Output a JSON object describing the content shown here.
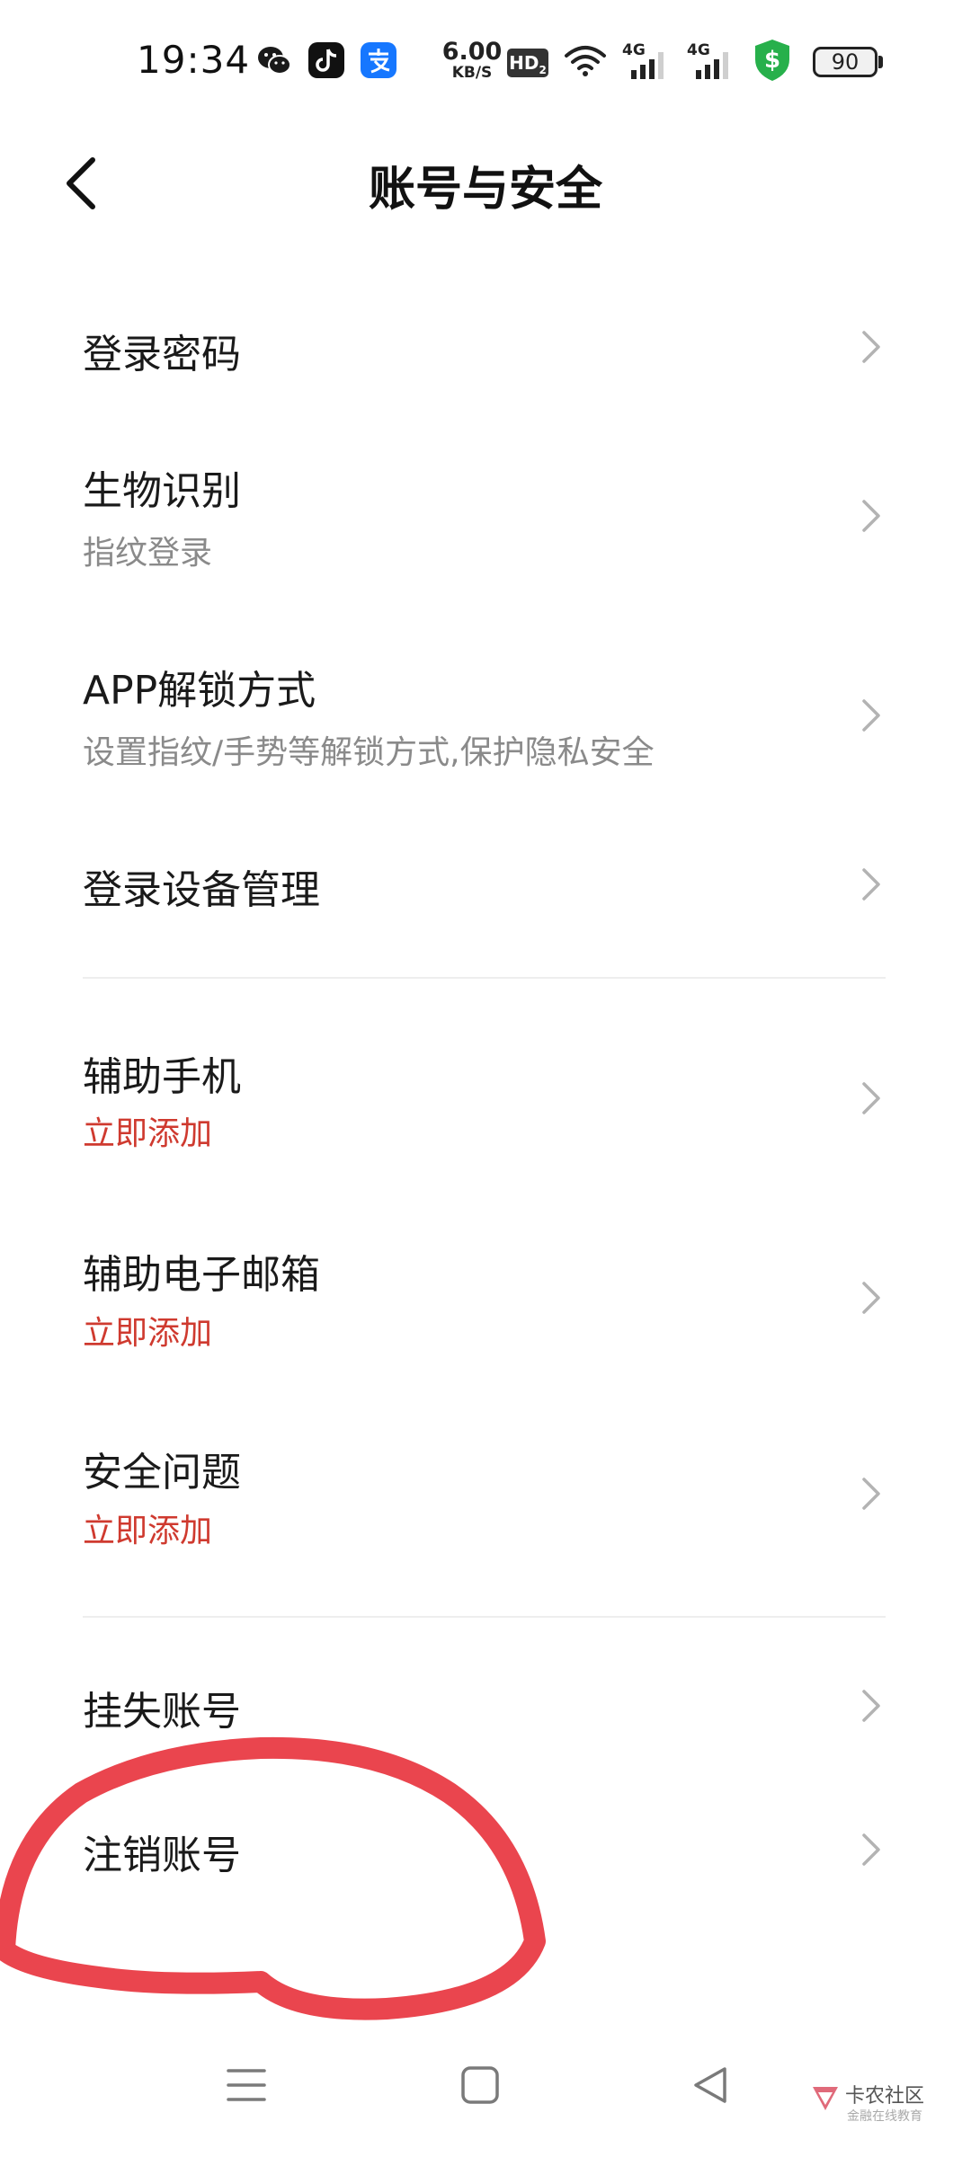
{
  "status_bar": {
    "time": "19:34",
    "net_speed_value": "6.00",
    "net_speed_unit": "KB/S",
    "hd_badge": "HD",
    "hd_sub": "2",
    "signal1_label": "4G",
    "signal2_label": "4G",
    "battery_level": "90",
    "icons": [
      "wechat-icon",
      "tiktok-icon",
      "alipay-icon",
      "hd-icon",
      "wifi-icon",
      "signal-icon",
      "signal-icon",
      "shield-dollar-icon",
      "battery-icon"
    ]
  },
  "header": {
    "title": "账号与安全"
  },
  "settings": {
    "items": [
      {
        "title": "登录密码",
        "subtitle": ""
      },
      {
        "title": "生物识别",
        "subtitle": "指纹登录"
      },
      {
        "title": "APP解锁方式",
        "subtitle": "设置指纹/手势等解锁方式,保护隐私安全"
      },
      {
        "title": "登录设备管理",
        "subtitle": ""
      },
      {
        "title": "辅助手机",
        "subtitle": "立即添加"
      },
      {
        "title": "辅助电子邮箱",
        "subtitle": "立即添加"
      },
      {
        "title": "安全问题",
        "subtitle": "立即添加"
      },
      {
        "title": "挂失账号",
        "subtitle": ""
      },
      {
        "title": "注销账号",
        "subtitle": ""
      }
    ]
  },
  "colors": {
    "accent_red": "#cf3a2f",
    "annotation_red": "#e8353f",
    "wechat": "#1a1a1a",
    "alipay": "#1677ff",
    "shield": "#27b04b"
  },
  "watermark": {
    "text": "卡农社区",
    "sub": "金融在线教育"
  }
}
